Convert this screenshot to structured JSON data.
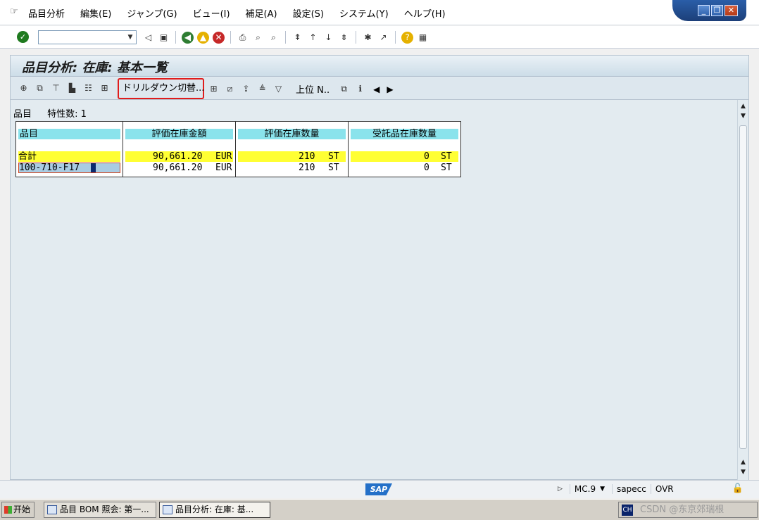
{
  "menubar": {
    "items": [
      "品目分析",
      "編集(E)",
      "ジャンプ(G)",
      "ビュー(I)",
      "補足(A)",
      "設定(S)",
      "システム(Y)",
      "ヘルプ(H)"
    ]
  },
  "window_controls": {
    "minimize": "_",
    "restore": "❐",
    "close": "✕"
  },
  "screen": {
    "title": "品目分析: 在庫: 基本一覧",
    "drilldown_button": "ドリルダウン切替...",
    "upper_level_button": "上位 N..",
    "characteristic_label": "品目",
    "characteristic_count": "特性数: 1"
  },
  "table": {
    "headers": [
      "品目",
      "評価在庫金額",
      "評価在庫数量",
      "受託品在庫数量"
    ],
    "total_row": {
      "label": "合計",
      "value_amount": "90,661.20",
      "value_currency": "EUR",
      "qty_amount": "210",
      "qty_unit": "ST",
      "consign_amount": "0",
      "consign_unit": "ST"
    },
    "item_row": {
      "label": "100-710-F17",
      "value_amount": "90,661.20",
      "value_currency": "EUR",
      "qty_amount": "210",
      "qty_unit": "ST",
      "consign_amount": "0",
      "consign_unit": "ST"
    }
  },
  "statusbar": {
    "logo": "SAP",
    "transaction": "MC.9",
    "server": "sapecc",
    "mode": "OVR"
  },
  "taskbar": {
    "start": "开始",
    "tasks": [
      "品目 BOM 照会: 第一...",
      "品目分析: 在庫: 基..."
    ],
    "tray_text": "CSDN @东京郊瑞根"
  }
}
